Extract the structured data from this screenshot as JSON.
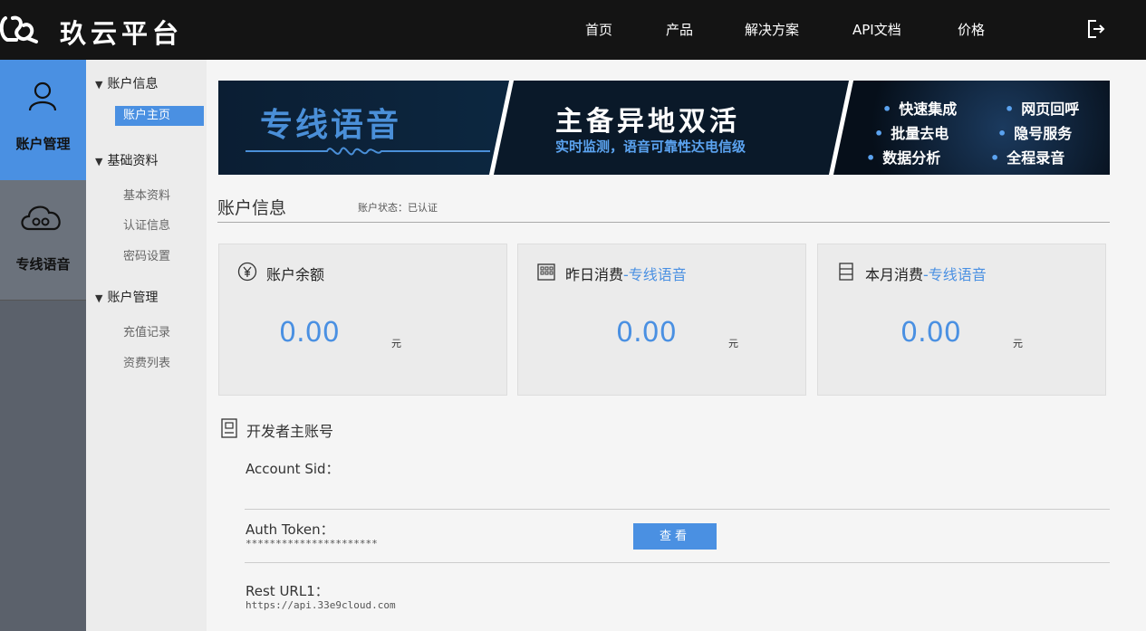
{
  "header": {
    "brand": "玖云平台",
    "nav": [
      "首页",
      "产品",
      "解决方案",
      "API文档",
      "价格"
    ]
  },
  "iconcol": {
    "items": [
      {
        "label": "账户管理",
        "icon": "user-icon"
      },
      {
        "label": "专线语音",
        "icon": "cloud-icon"
      }
    ]
  },
  "submenu": {
    "groups": [
      {
        "title": "账户信息",
        "items": [
          "账户主页"
        ]
      },
      {
        "title": "基础资料",
        "items": [
          "基本资料",
          "认证信息",
          "密码设置"
        ]
      },
      {
        "title": "账户管理",
        "items": [
          "充值记录",
          "资费列表"
        ]
      }
    ]
  },
  "banner": {
    "left_title": "专线语音",
    "mid_title": "主备异地双活",
    "mid_sub": "实时监测，语音可靠性达电信级",
    "features": [
      "快速集成",
      "网页回呼",
      "批量去电",
      "隐号服务",
      "数据分析",
      "全程录音"
    ]
  },
  "account": {
    "title": "账户信息",
    "status": "账户状态：已认证"
  },
  "cards": [
    {
      "title": "账户余额",
      "suffix": "",
      "value": "0.00",
      "unit": "元",
      "icon": "yen-icon"
    },
    {
      "title": "昨日消费",
      "suffix": "-专线语音",
      "value": "0.00",
      "unit": "元",
      "icon": "calendar-icon"
    },
    {
      "title": "本月消费",
      "suffix": "-专线语音",
      "value": "0.00",
      "unit": "元",
      "icon": "list-icon"
    }
  ],
  "developer": {
    "title": "开发者主账号",
    "account_sid_label": "Account Sid：",
    "account_sid_value": "",
    "auth_token_label": "Auth Token：",
    "auth_token_value": "**********************",
    "view_button": "查看",
    "rest_url_label": "Rest URL1：",
    "rest_url_value": "https://api.33e9cloud.com"
  },
  "colors": {
    "accent": "#4a90e2",
    "topbar": "#141414",
    "iconcol": "#5b616b"
  }
}
